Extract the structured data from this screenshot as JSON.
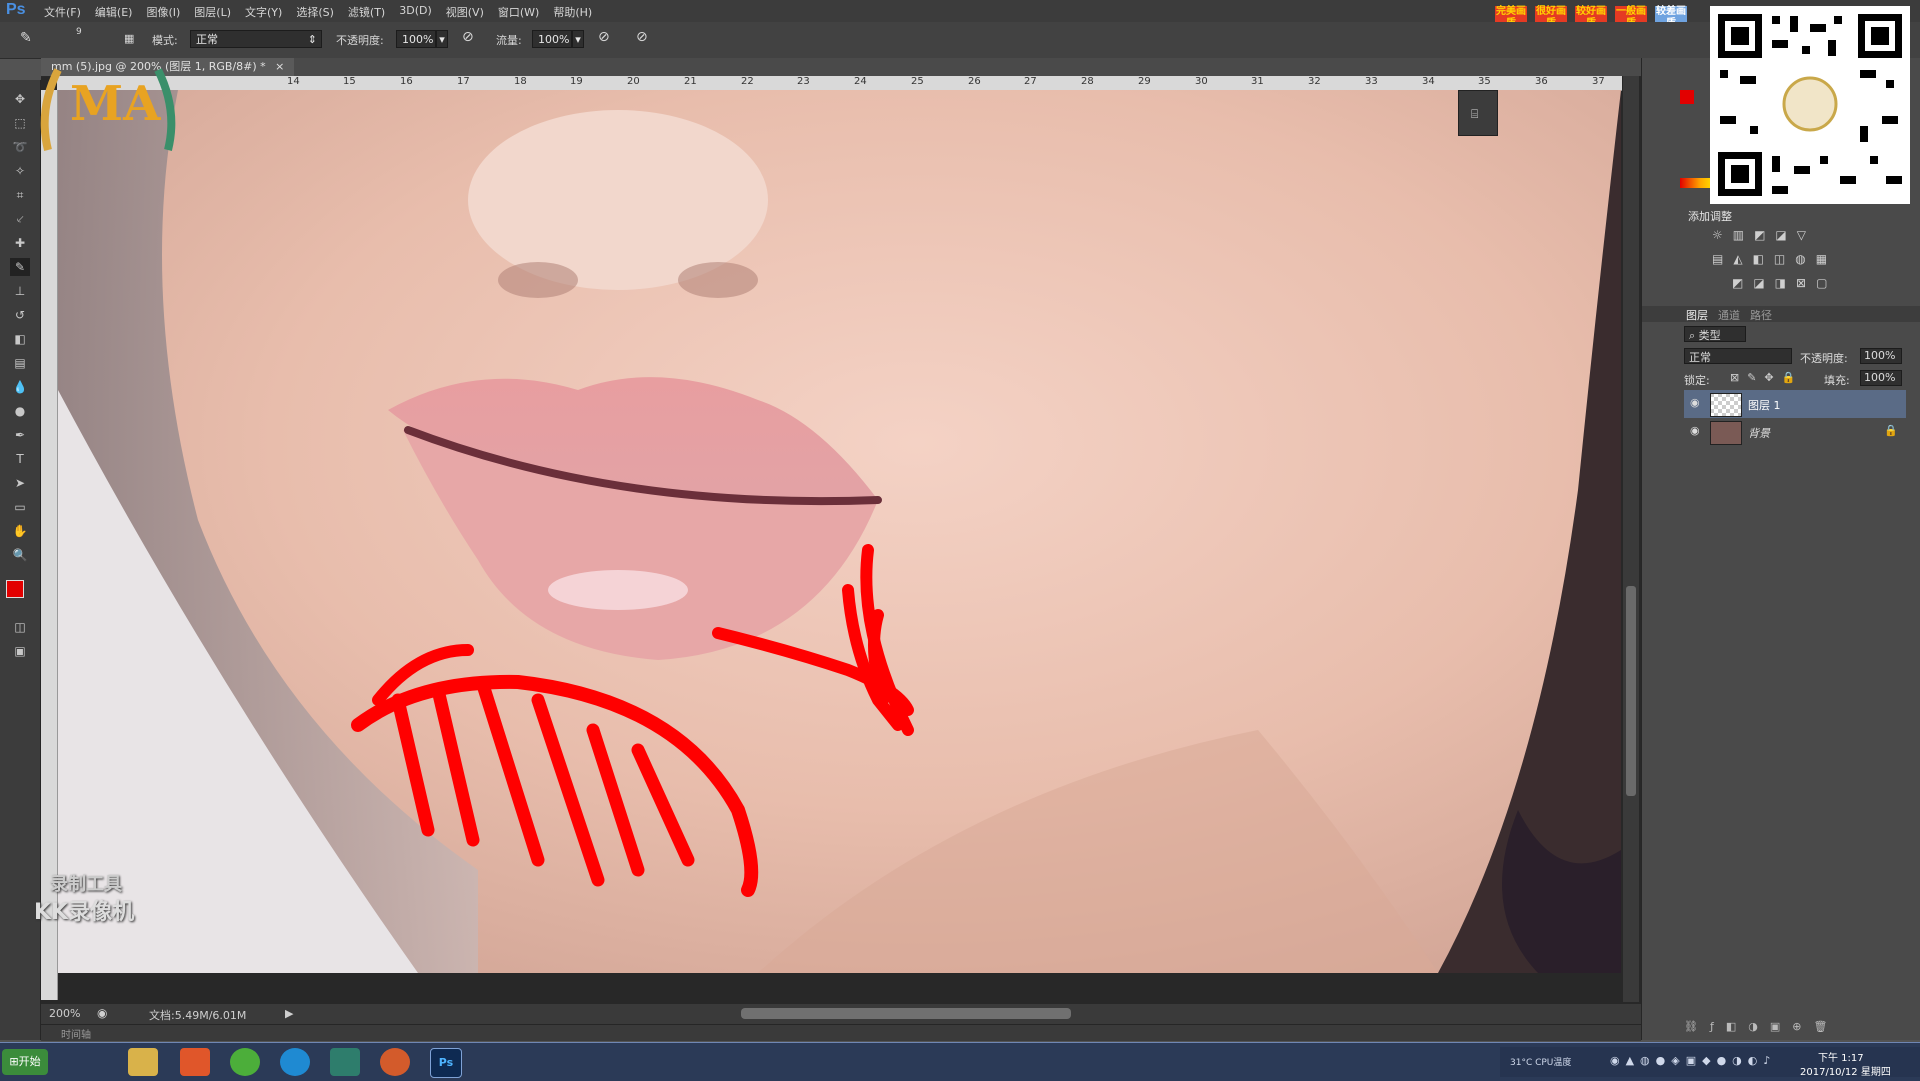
{
  "app": {
    "logo_text": "Ps",
    "menu": [
      "文件(F)",
      "编辑(E)",
      "图像(I)",
      "图层(L)",
      "文字(Y)",
      "选择(S)",
      "滤镜(T)",
      "3D(D)",
      "视图(V)",
      "窗口(W)",
      "帮助(H)"
    ]
  },
  "options_bar": {
    "brush_size": "9",
    "mode_label": "模式:",
    "mode_value": "正常",
    "opacity_label": "不透明度:",
    "opacity_value": "100%",
    "flow_label": "流量:",
    "flow_value": "100%"
  },
  "document": {
    "tab_title": "mm (5).jpg @ 200% (图层 1, RGB/8#) *",
    "zoom": "200%",
    "doc_info": "文档:5.49M/6.01M",
    "ruler_labels": [
      "14",
      "15",
      "16",
      "17",
      "18",
      "19",
      "20",
      "21",
      "22",
      "23",
      "24",
      "25",
      "26",
      "27",
      "28",
      "29",
      "30",
      "31",
      "32",
      "33",
      "34",
      "35",
      "36",
      "37"
    ]
  },
  "watermark": {
    "line1": "录制工具",
    "line2": "KK录像机"
  },
  "adjustments": {
    "title": "添加调整"
  },
  "layers_panel": {
    "tabs": [
      "图层",
      "通道",
      "路径"
    ],
    "filter_label": "类型",
    "blend_mode": "正常",
    "opacity_label": "不透明度:",
    "opacity_value": "100%",
    "lock_label": "锁定:",
    "fill_label": "填充:",
    "fill_value": "100%",
    "layers": [
      {
        "name": "图层 1",
        "selected": true
      },
      {
        "name": "背景",
        "selected": false
      }
    ]
  },
  "ad_badges": [
    "完美画质",
    "很好画质",
    "较好画质",
    "一般画质",
    "较差画质"
  ],
  "taskbar": {
    "start_label": "开始",
    "tray_time": "下午 1:17",
    "tray_date": "2017/10/12 星期四",
    "cpu_label": "31°C CPU温度"
  },
  "bottom_label": "时间轴",
  "colors": {
    "foreground": "#e20000",
    "background": "#1fc21f",
    "annotation_red": "#ff0000"
  }
}
